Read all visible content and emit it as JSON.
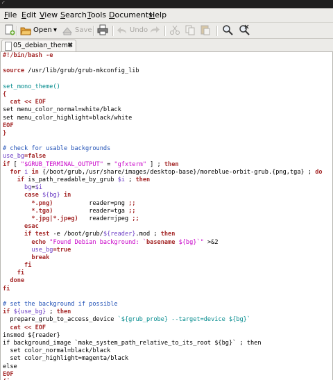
{
  "colors": {
    "keyword": "#a52a2a",
    "comment": "#1d4eb5",
    "string": "#c800c8",
    "variable": "#6a3bc4",
    "function": "#008a8c",
    "chrome": "#ecebe8"
  },
  "menubar": {
    "items": [
      {
        "u": "F",
        "rest": "ile"
      },
      {
        "u": "E",
        "rest": "dit"
      },
      {
        "u": "V",
        "rest": "iew"
      },
      {
        "u": "S",
        "rest": "earch"
      },
      {
        "u": "T",
        "rest": "ools"
      },
      {
        "u": "D",
        "rest": "ocuments"
      },
      {
        "u": "H",
        "rest": "elp"
      }
    ]
  },
  "toolbar": {
    "new_icon": "new-document-icon",
    "open_label": "Open",
    "save_label": "Save",
    "print_icon": "printer-icon",
    "undo_label": "Undo",
    "redo_icon": "redo-icon",
    "cut_icon": "scissors-icon",
    "copy_icon": "copy-icon",
    "paste_icon": "paste-icon",
    "find_icon": "magnifier-icon",
    "replace_icon": "find-replace-icon"
  },
  "tab": {
    "label": "05_debian_theme",
    "close": "✖"
  },
  "code_lines": [
    [
      {
        "t": "#!/bin/bash -e",
        "c": "kw"
      }
    ],
    [],
    [
      {
        "t": "source",
        "c": "kw"
      },
      {
        "t": " /usr/lib/grub/grub-mkconfig_lib"
      }
    ],
    [],
    [
      {
        "t": "set_mono_theme()",
        "c": "fn"
      }
    ],
    [
      {
        "t": "{",
        "c": "kw"
      }
    ],
    [
      {
        "t": "  "
      },
      {
        "t": "cat << EOF",
        "c": "kw"
      }
    ],
    [
      {
        "t": "set menu_color_normal=white/black"
      }
    ],
    [
      {
        "t": "set menu_color_highlight=black/white"
      }
    ],
    [
      {
        "t": "EOF",
        "c": "kw"
      }
    ],
    [
      {
        "t": "}",
        "c": "kw"
      }
    ],
    [],
    [
      {
        "t": "# check for usable backgrounds",
        "c": "cm"
      }
    ],
    [
      {
        "t": "use_bg",
        "c": "vr"
      },
      {
        "t": "=false",
        "c": "kw"
      }
    ],
    [
      {
        "t": "if",
        "c": "kw"
      },
      {
        "t": " [ "
      },
      {
        "t": "\"$GRUB_TERMINAL_OUTPUT\"",
        "c": "st"
      },
      {
        "t": " = "
      },
      {
        "t": "\"gfxterm\"",
        "c": "st"
      },
      {
        "t": " ] ; "
      },
      {
        "t": "then",
        "c": "kw"
      }
    ],
    [
      {
        "t": "  "
      },
      {
        "t": "for",
        "c": "kw"
      },
      {
        "t": " "
      },
      {
        "t": "i",
        "c": "vr"
      },
      {
        "t": " "
      },
      {
        "t": "in",
        "c": "kw"
      },
      {
        "t": " {/boot/grub,/usr/share/images/desktop-base}/moreblue-orbit-grub.{png,tga} ; "
      },
      {
        "t": "do",
        "c": "kw"
      }
    ],
    [
      {
        "t": "    "
      },
      {
        "t": "if",
        "c": "kw"
      },
      {
        "t": " is_path_readable_by_grub "
      },
      {
        "t": "$i",
        "c": "vr"
      },
      {
        "t": " ; "
      },
      {
        "t": "then",
        "c": "kw"
      }
    ],
    [
      {
        "t": "      "
      },
      {
        "t": "bg",
        "c": "vr"
      },
      {
        "t": "="
      },
      {
        "t": "$i",
        "c": "vr"
      }
    ],
    [
      {
        "t": "      "
      },
      {
        "t": "case",
        "c": "kw"
      },
      {
        "t": " "
      },
      {
        "t": "${bg}",
        "c": "vr"
      },
      {
        "t": " "
      },
      {
        "t": "in",
        "c": "kw"
      }
    ],
    [
      {
        "t": "        "
      },
      {
        "t": "*.png)",
        "c": "kw"
      },
      {
        "t": "          reader=png "
      },
      {
        "t": ";;",
        "c": "kw"
      }
    ],
    [
      {
        "t": "        "
      },
      {
        "t": "*.tga)",
        "c": "kw"
      },
      {
        "t": "          reader=tga "
      },
      {
        "t": ";;",
        "c": "kw"
      }
    ],
    [
      {
        "t": "        "
      },
      {
        "t": "*.jpg|*.jpeg)",
        "c": "kw"
      },
      {
        "t": "   reader=jpeg "
      },
      {
        "t": ";;",
        "c": "kw"
      }
    ],
    [
      {
        "t": "      "
      },
      {
        "t": "esac",
        "c": "kw"
      }
    ],
    [
      {
        "t": "      "
      },
      {
        "t": "if",
        "c": "kw"
      },
      {
        "t": " "
      },
      {
        "t": "test",
        "c": "kw"
      },
      {
        "t": " -e /boot/grub/"
      },
      {
        "t": "${reader}",
        "c": "vr"
      },
      {
        "t": ".mod ; "
      },
      {
        "t": "then",
        "c": "kw"
      }
    ],
    [
      {
        "t": "        "
      },
      {
        "t": "echo",
        "c": "kw"
      },
      {
        "t": " "
      },
      {
        "t": "\"Found Debian background: `",
        "c": "st"
      },
      {
        "t": "basename",
        "c": "kw"
      },
      {
        "t": " ${bg}`\"",
        "c": "st"
      },
      {
        "t": " >&2"
      }
    ],
    [
      {
        "t": "        "
      },
      {
        "t": "use_bg",
        "c": "vr"
      },
      {
        "t": "=true",
        "c": "kw"
      }
    ],
    [
      {
        "t": "        "
      },
      {
        "t": "break",
        "c": "kw"
      }
    ],
    [
      {
        "t": "      "
      },
      {
        "t": "fi",
        "c": "kw"
      }
    ],
    [
      {
        "t": "    "
      },
      {
        "t": "fi",
        "c": "kw"
      }
    ],
    [
      {
        "t": "  "
      },
      {
        "t": "done",
        "c": "kw"
      }
    ],
    [
      {
        "t": "fi",
        "c": "kw"
      }
    ],
    [],
    [
      {
        "t": "# set the background if possible",
        "c": "cm"
      }
    ],
    [
      {
        "t": "if",
        "c": "kw"
      },
      {
        "t": " "
      },
      {
        "t": "${use_bg}",
        "c": "vr"
      },
      {
        "t": " ; "
      },
      {
        "t": "then",
        "c": "kw"
      }
    ],
    [
      {
        "t": "  prepare_grub_to_access_device "
      },
      {
        "t": "`${grub_probe} --target=device ${bg}`",
        "c": "fn"
      }
    ],
    [
      {
        "t": "  "
      },
      {
        "t": "cat << EOF",
        "c": "kw"
      }
    ],
    [
      {
        "t": "insmod ${reader}"
      }
    ],
    [
      {
        "t": "if background_image `make_system_path_relative_to_its_root ${bg}` ; then"
      }
    ],
    [
      {
        "t": "  set color_normal=black/black"
      }
    ],
    [
      {
        "t": "  set color_highlight=magenta/black"
      }
    ],
    [
      {
        "t": "else"
      }
    ],
    [
      {
        "t": "EOF",
        "c": "kw"
      }
    ],
    [
      {
        "t": "fi",
        "c": "kw"
      }
    ]
  ]
}
